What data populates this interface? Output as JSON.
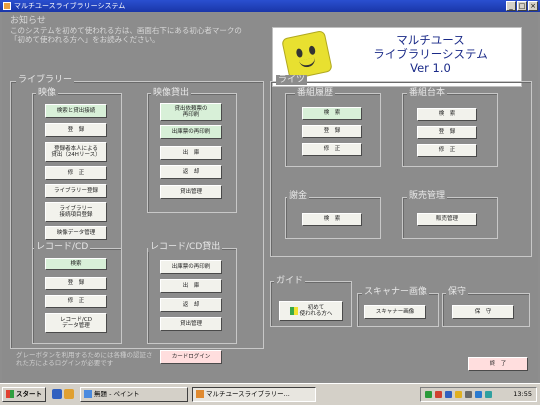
{
  "window": {
    "title": "マルチユースライブラリーシステム"
  },
  "notice": {
    "title": "お知らせ",
    "body": "このシステムを初めて使われる方は、画面右下にある初心者マークの「初めて使われる方へ」をお読みください。"
  },
  "logo": {
    "title": "マルチユース\nライブラリーシステム\nVer 1.0"
  },
  "library": {
    "label": "ライブラリー",
    "video": {
      "label": "映像",
      "buttons": [
        "検索と貸出接続",
        "登　録",
        "登録者本人による\n貸出（24Hリース）",
        "修　正",
        "ライブラリー登録",
        "ライブラリー\n接続項目登録",
        "映像データ管理"
      ]
    },
    "video_lending": {
      "label": "映像貸出",
      "buttons": [
        "貸出依頼票の\n再印刷",
        "出庫票の再印刷",
        "出　庫",
        "返　却",
        "貸出管理"
      ]
    },
    "record": {
      "label": "レコード/CD",
      "buttons": [
        "検索",
        "登　録",
        "修　正",
        "レコード/CD\nデータ管理"
      ]
    },
    "record_lending": {
      "label": "レコード/CD貸出",
      "buttons": [
        "出庫票の再印刷",
        "出　庫",
        "返　却",
        "貸出管理"
      ]
    }
  },
  "rights": {
    "label": "ライツ",
    "history": {
      "label": "番組履歴",
      "buttons": [
        "検　索",
        "登　録",
        "修　正"
      ]
    },
    "ledger": {
      "label": "番組台本",
      "buttons": [
        "検　索",
        "登　録",
        "修　正"
      ]
    },
    "fees": {
      "label": "謝金",
      "buttons": [
        "検　索"
      ]
    },
    "sales": {
      "label": "販売管理",
      "buttons": [
        "販売管理"
      ]
    }
  },
  "guide": {
    "label": "ガイド",
    "button": "初めて\n使われる方へ"
  },
  "scanner": {
    "label": "スキャナー画像",
    "button": "スキャナー画像"
  },
  "maintenance": {
    "label": "保守",
    "button": "保　守"
  },
  "footnote": "グレーボタンを利用するためには各種の認証された方によるログインが必要です",
  "card_login": "カードログイン",
  "exit_button": "終　了",
  "taskbar": {
    "start": "スタート",
    "tasks": [
      "無題 - ペイント",
      "マルチユースライブラリー..."
    ],
    "clock": "13:55"
  },
  "colors": {
    "titlebar": "#1a36a8",
    "background": "#8c8c8c",
    "green_button": "#d8f0d8",
    "card_login": "#ffdede"
  }
}
